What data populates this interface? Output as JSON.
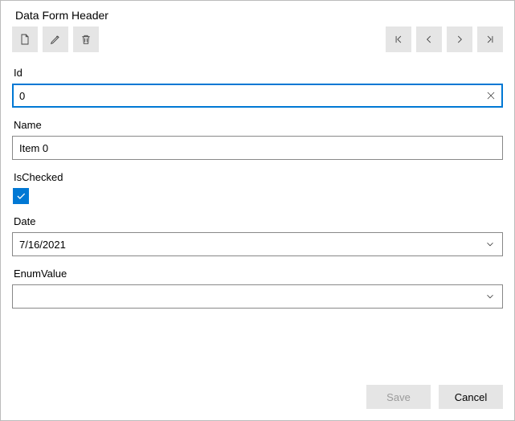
{
  "header": {
    "title": "Data Form Header"
  },
  "toolbar": {
    "left": [
      {
        "icon": "new-file-icon"
      },
      {
        "icon": "edit-icon"
      },
      {
        "icon": "delete-icon"
      }
    ],
    "nav": [
      {
        "icon": "nav-first-icon"
      },
      {
        "icon": "nav-prev-icon"
      },
      {
        "icon": "nav-next-icon"
      },
      {
        "icon": "nav-last-icon"
      }
    ]
  },
  "fields": {
    "id": {
      "label": "Id",
      "value": "0"
    },
    "name": {
      "label": "Name",
      "value": "Item 0"
    },
    "ischecked": {
      "label": "IsChecked",
      "value": true
    },
    "date": {
      "label": "Date",
      "value": "7/16/2021"
    },
    "enumvalue": {
      "label": "EnumValue",
      "value": ""
    }
  },
  "footer": {
    "save_label": "Save",
    "cancel_label": "Cancel",
    "save_enabled": false
  }
}
